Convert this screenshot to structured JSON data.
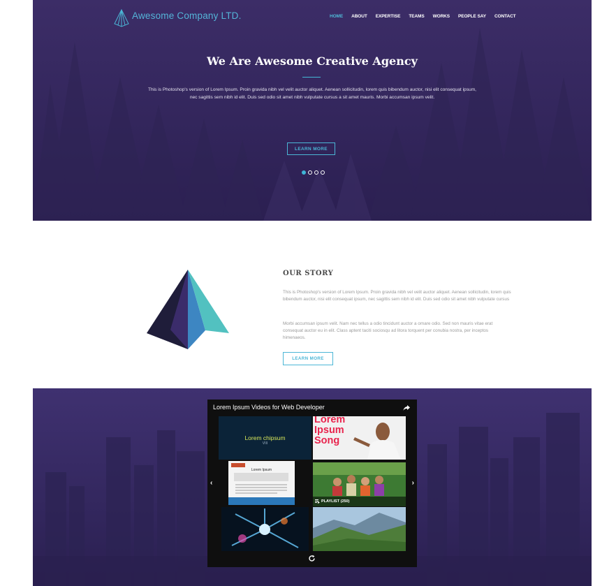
{
  "brand": {
    "name": "Awesome Company LTD.",
    "accent": "#4bb6d6"
  },
  "nav": {
    "items": [
      {
        "label": "HOME",
        "active": true
      },
      {
        "label": "ABOUT"
      },
      {
        "label": "EXPERTISE"
      },
      {
        "label": "TEAMS"
      },
      {
        "label": "WORKS"
      },
      {
        "label": "PEOPLE SAY"
      },
      {
        "label": "CONTACT"
      }
    ]
  },
  "hero": {
    "title": "We Are Awesome Creative Agency",
    "text": "This is Photoshop's version of Lorem Ipsum. Proin gravida nibh vel velit auctor aliquet. Aenean sollicitudin, lorem quis bibendum auctor, nisi elit consequat ipsum, nec sagittis sem nibh id elit. Duis sed odio sit amet nibh vulputate cursus a sit amet mauris. Morbi accumsan ipsum velit.",
    "button": "LEARN MORE",
    "slides": 4,
    "active_slide": 1
  },
  "story": {
    "title": "OUR STORY",
    "p1": "This is Photoshop's version of Lorem Ipsum. Proin gravida nibh vel velit auctor aliquet. Aenean sollicitudin, lorem quis bibendum auctor, nisi elit consequat ipsum, nec sagittis sem nibh id elit. Duis sed odio sit amet nibh vulputate cursus",
    "p2": "Morbi accumsan ipsum velit. Nam nec tellus a odio tincidunt auctor a ornare odio. Sed non mauris vitae erat consequat auctor eu in elit. Class aptent taciti sociosqu ad litora torquent per conubia nostra, per inceptos himenaeos.",
    "button": "LEARN MORE"
  },
  "video": {
    "title": "Lorem Ipsum Videos for Web Developer",
    "thumb1_title": "Lorem chipsum",
    "thumb1_sub": "VIII",
    "thumb2_title_lines": [
      "Lorem",
      "Ipsum",
      "Song"
    ],
    "thumb3_title": "Lorem Ipsum",
    "playlist_label": "PLAYLIST (250)",
    "prev_arrow": "‹",
    "next_arrow": "›",
    "icons": [
      "share-icon",
      "playlist-icon",
      "reload-icon"
    ]
  }
}
